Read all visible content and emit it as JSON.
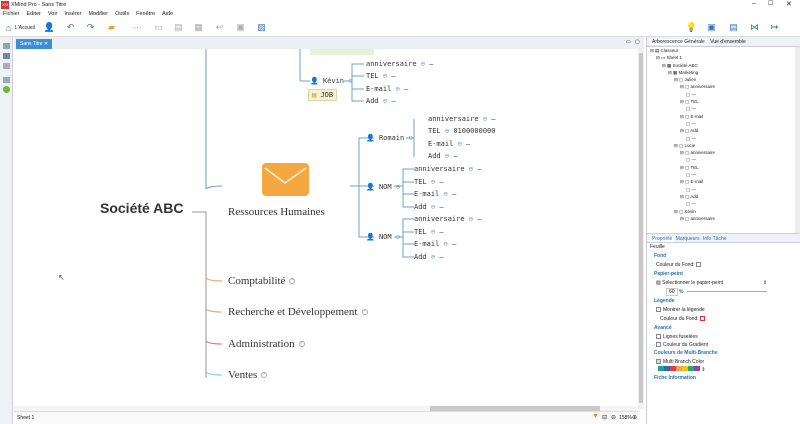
{
  "app": {
    "title": "XMind Pro - Sans Titre",
    "logo": "XM"
  },
  "menu": [
    "Fichier",
    "Editer",
    "Voir",
    "Insérer",
    "Modifier",
    "Outils",
    "Fenêtre",
    "Aide"
  ],
  "toolbar": {
    "home_label": "L'Accueil"
  },
  "editor": {
    "tab": "Sans Titre",
    "sheet": "Sheet 1",
    "zoom": "158%"
  },
  "map": {
    "central": "Société ABC",
    "branch": "Ressources Humaines",
    "others": [
      "Comptabilité",
      "Recherche et Développement",
      "Administration",
      "Ventes"
    ],
    "kevin": {
      "name": "Kévin",
      "label": "JOB",
      "fields": [
        "anniversaire",
        "TEL",
        "E-mail",
        "Add"
      ]
    },
    "romain": {
      "name": "Romain",
      "fields": [
        "anniversaire",
        "TEL",
        "E-mail",
        "Add"
      ],
      "tel_value": "0100000000"
    },
    "nom1": {
      "name": "NOM",
      "fields": [
        "anniversaire",
        "TEL",
        "E-mail",
        "Add"
      ]
    },
    "nom2": {
      "name": "NOM",
      "fields": [
        "anniversaire",
        "TEL",
        "E-mail",
        "Add"
      ]
    },
    "dash": "—"
  },
  "outline": {
    "tabs": [
      "Arborescence Générale",
      "Vue d'ensemble"
    ],
    "items": [
      "Classeur",
      "Sheet 1",
      "Société ABC",
      "Marketing",
      "Julien",
      "anniversaire",
      "—",
      "TEL",
      "—",
      "E-mail",
      "—",
      "Add",
      "—",
      "Lucie",
      "anniversaire",
      "—",
      "TEL",
      "—",
      "E-mail",
      "—",
      "Add",
      "—",
      "Kévin",
      "anniversaire"
    ]
  },
  "props": {
    "tabs": [
      "Propriété",
      "Marqueurs",
      "Info Tâche"
    ],
    "section": "Feuille",
    "fond": "Fond",
    "couleur_fond": "Couleur du Fond:",
    "papier": "Papier-peint",
    "select_papier": "Sélectionner le papier-peint",
    "opacity": "60",
    "pct": "%",
    "legende": "Légende",
    "montrer": "Montrer la légende",
    "couleur_fond2": "Couleur du Fond:",
    "avance": "Avancé",
    "lignes": "Lignes fuselées",
    "gradient": "Couleur du Gradient",
    "multi": "Couleurs de Multi-Branche",
    "multi_opt": "Multi Branch Color",
    "fiche": "Fiche Information",
    "swatches": [
      "#2a9d8f",
      "#1f6fb2",
      "#e63946",
      "#f4a261",
      "#f1c40f",
      "#27ae60",
      "#8e44ad"
    ]
  },
  "colors": {
    "accent": "#3b8fd8",
    "branch": "#3a6fb0"
  }
}
